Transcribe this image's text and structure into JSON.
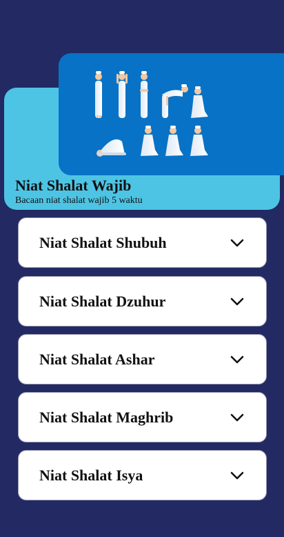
{
  "header": {
    "title": "Niat Shalat Wajib",
    "subtitle": "Bacaan niat shalat wajib 5 waktu",
    "banner_image": "prayer-positions-illustration"
  },
  "prayers": [
    {
      "label": "Niat Shalat Shubuh",
      "icon": "chevron-down-icon"
    },
    {
      "label": "Niat Shalat Dzuhur",
      "icon": "chevron-down-icon"
    },
    {
      "label": "Niat Shalat Ashar",
      "icon": "chevron-down-icon"
    },
    {
      "label": "Niat Shalat Maghrib",
      "icon": "chevron-down-icon"
    },
    {
      "label": "Niat Shalat Isya",
      "icon": "chevron-down-icon"
    }
  ],
  "colors": {
    "background": "#232a63",
    "header_card": "#4ec4e4",
    "image_card": "#0872c6",
    "accordion": "#ffffff"
  }
}
